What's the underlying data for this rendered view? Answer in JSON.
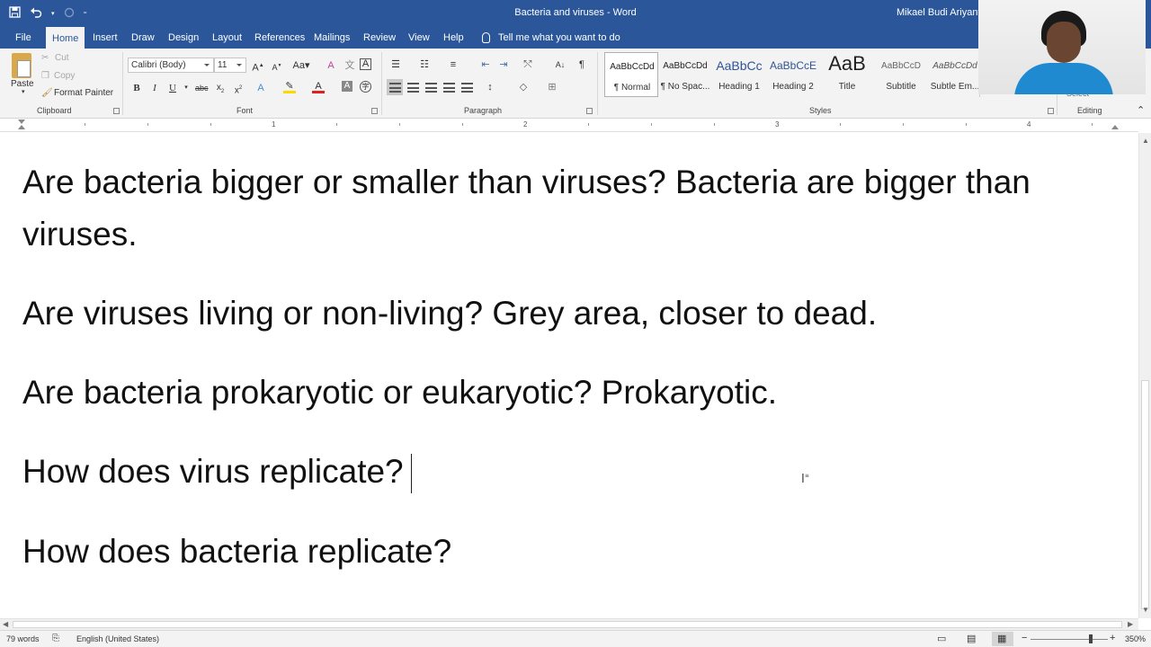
{
  "window": {
    "doc_title": "Bacteria and viruses - Word",
    "user_name": "Mikael Budi Ariyanto"
  },
  "tabs": [
    "File",
    "Home",
    "Insert",
    "Draw",
    "Design",
    "Layout",
    "References",
    "Mailings",
    "Review",
    "View",
    "Help"
  ],
  "tell_me": "Tell me what you want to do",
  "ribbon": {
    "clipboard": {
      "paste": "Paste",
      "cut": "Cut",
      "copy": "Copy",
      "format_painter": "Format Painter",
      "label": "Clipboard"
    },
    "font": {
      "name": "Calibri (Body)",
      "size": "11",
      "label": "Font"
    },
    "paragraph": {
      "label": "Paragraph"
    },
    "styles": {
      "label": "Styles",
      "items": [
        {
          "preview": "AaBbCcDd",
          "name": "¶ Normal"
        },
        {
          "preview": "AaBbCcDd",
          "name": "¶ No Spac..."
        },
        {
          "preview": "AaBbCc",
          "name": "Heading 1"
        },
        {
          "preview": "AaBbCcE",
          "name": "Heading 2"
        },
        {
          "preview": "AaB",
          "name": "Title"
        },
        {
          "preview": "AaBbCcD",
          "name": "Subtitle"
        },
        {
          "preview": "AaBbCcDd",
          "name": "Subtle Em..."
        }
      ]
    },
    "editing": {
      "select": "Select",
      "label": "Editing"
    }
  },
  "ruler": [
    "1",
    "2",
    "3",
    "4"
  ],
  "document": {
    "paragraphs": [
      "Are bacteria bigger or smaller than viruses? Bacteria are bigger than viruses.",
      "Are viruses living or non-living? Grey area, closer to dead.",
      "Are bacteria prokaryotic or eukaryotic? Prokaryotic.",
      "How does virus replicate?",
      "How does bacteria replicate?"
    ]
  },
  "status": {
    "words": "79 words",
    "language": "English (United States)",
    "zoom": "350%",
    "zoom_minus": "−",
    "zoom_plus": "+"
  }
}
